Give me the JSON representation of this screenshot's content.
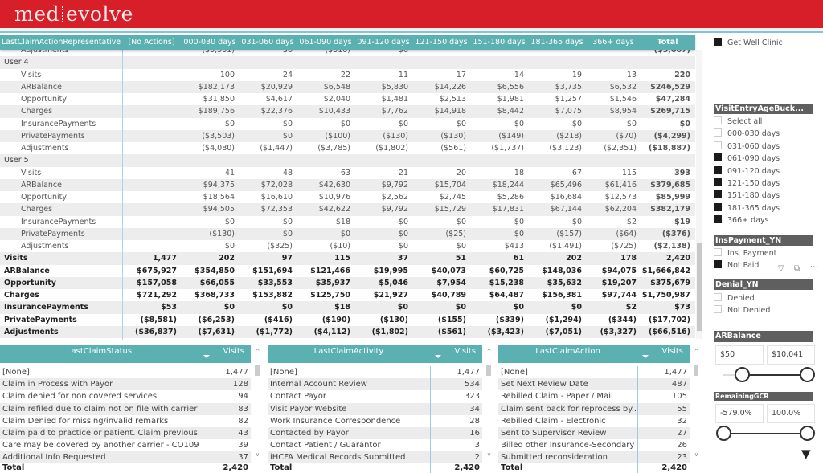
{
  "brand": {
    "logo_left": "med",
    "logo_right": "evolve",
    "color": "#d71f2a",
    "accent": "#5bb0b2"
  },
  "matrix": {
    "headers": [
      "LastClaimActionRepresentative",
      "[No Actions]",
      "000-030 days",
      "031-060 days",
      "061-090 days",
      "091-120 days",
      "121-150 days",
      "151-180 days",
      "181-365 days",
      "366+ days",
      "Total"
    ],
    "rows": [
      {
        "type": "sub",
        "cells": [
          "Adjustments",
          "",
          "($5,551)",
          "$0",
          "($310)",
          "$0",
          "",
          "",
          "",
          "",
          "($5,667)"
        ]
      },
      {
        "type": "grp",
        "cells": [
          "User 4",
          "",
          "",
          "",
          "",
          "",
          "",
          "",
          "",
          "",
          ""
        ]
      },
      {
        "type": "sub",
        "cells": [
          "Visits",
          "",
          "100",
          "24",
          "22",
          "11",
          "17",
          "14",
          "19",
          "13",
          "220"
        ]
      },
      {
        "type": "sub",
        "cells": [
          "ARBalance",
          "",
          "$182,173",
          "$20,929",
          "$6,548",
          "$5,830",
          "$14,226",
          "$6,556",
          "$3,735",
          "$6,532",
          "$246,529"
        ]
      },
      {
        "type": "sub",
        "cells": [
          "Opportunity",
          "",
          "$31,850",
          "$4,617",
          "$2,040",
          "$1,481",
          "$2,513",
          "$1,981",
          "$1,257",
          "$1,546",
          "$47,284"
        ]
      },
      {
        "type": "sub",
        "cells": [
          "Charges",
          "",
          "$189,756",
          "$22,376",
          "$10,433",
          "$7,762",
          "$14,918",
          "$8,442",
          "$7,075",
          "$8,954",
          "$269,715"
        ]
      },
      {
        "type": "sub",
        "cells": [
          "InsurancePayments",
          "",
          "$0",
          "$0",
          "$0",
          "$0",
          "$0",
          "$0",
          "$0",
          "$0",
          "$0"
        ]
      },
      {
        "type": "sub",
        "cells": [
          "PrivatePayments",
          "",
          "($3,503)",
          "$0",
          "($100)",
          "($130)",
          "($130)",
          "($149)",
          "($218)",
          "($70)",
          "($4,299)"
        ]
      },
      {
        "type": "sub",
        "cells": [
          "Adjustments",
          "",
          "($4,080)",
          "($1,447)",
          "($3,785)",
          "($1,802)",
          "($561)",
          "($1,737)",
          "($3,123)",
          "($2,351)",
          "($18,887)"
        ]
      },
      {
        "type": "grp",
        "cells": [
          "User 5",
          "",
          "",
          "",
          "",
          "",
          "",
          "",
          "",
          "",
          ""
        ]
      },
      {
        "type": "sub",
        "cells": [
          "Visits",
          "",
          "41",
          "48",
          "63",
          "21",
          "20",
          "18",
          "67",
          "115",
          "393"
        ]
      },
      {
        "type": "sub",
        "cells": [
          "ARBalance",
          "",
          "$94,375",
          "$72,028",
          "$42,630",
          "$9,792",
          "$15,704",
          "$18,244",
          "$65,496",
          "$61,416",
          "$379,685"
        ]
      },
      {
        "type": "sub",
        "cells": [
          "Opportunity",
          "",
          "$18,564",
          "$16,610",
          "$10,976",
          "$2,562",
          "$2,745",
          "$5,286",
          "$16,684",
          "$12,573",
          "$85,999"
        ]
      },
      {
        "type": "sub",
        "cells": [
          "Charges",
          "",
          "$94,505",
          "$72,353",
          "$42,622",
          "$9,792",
          "$15,729",
          "$17,831",
          "$67,144",
          "$62,204",
          "$382,179"
        ]
      },
      {
        "type": "sub",
        "cells": [
          "InsurancePayments",
          "",
          "$0",
          "$0",
          "$18",
          "$0",
          "$0",
          "$0",
          "$0",
          "$2",
          "$19"
        ]
      },
      {
        "type": "sub",
        "cells": [
          "PrivatePayments",
          "",
          "($130)",
          "$0",
          "$0",
          "$0",
          "($25)",
          "$0",
          "($157)",
          "($64)",
          "($376)"
        ]
      },
      {
        "type": "sub",
        "cells": [
          "Adjustments",
          "",
          "$0",
          "($325)",
          "($10)",
          "$0",
          "$0",
          "$413",
          "($1,491)",
          "($725)",
          "($2,138)"
        ]
      },
      {
        "type": "tot",
        "cells": [
          "Visits",
          "1,477",
          "202",
          "97",
          "115",
          "37",
          "51",
          "61",
          "202",
          "178",
          "2,420"
        ]
      },
      {
        "type": "tot",
        "cells": [
          "ARBalance",
          "$675,927",
          "$354,850",
          "$151,694",
          "$121,466",
          "$19,995",
          "$40,073",
          "$60,725",
          "$148,036",
          "$94,075",
          "$1,666,842"
        ]
      },
      {
        "type": "tot",
        "cells": [
          "Opportunity",
          "$157,058",
          "$66,055",
          "$33,553",
          "$35,937",
          "$5,046",
          "$7,954",
          "$15,238",
          "$35,632",
          "$19,207",
          "$375,679"
        ]
      },
      {
        "type": "tot",
        "cells": [
          "Charges",
          "$721,292",
          "$368,733",
          "$153,882",
          "$125,750",
          "$21,927",
          "$40,789",
          "$64,487",
          "$156,381",
          "$97,744",
          "$1,750,987"
        ]
      },
      {
        "type": "tot",
        "cells": [
          "InsurancePayments",
          "$53",
          "$0",
          "$0",
          "$18",
          "$0",
          "$0",
          "$0",
          "$0",
          "$2",
          "$73"
        ]
      },
      {
        "type": "tot",
        "cells": [
          "PrivatePayments",
          "($8,581)",
          "($6,253)",
          "($416)",
          "($190)",
          "($130)",
          "($155)",
          "($339)",
          "($1,294)",
          "($344)",
          "($17,702)"
        ]
      },
      {
        "type": "tot",
        "cells": [
          "Adjustments",
          "($36,837)",
          "($7,631)",
          "($1,772)",
          "($4,112)",
          "($1,802)",
          "($561)",
          "($3,423)",
          "($7,051)",
          "($3,327)",
          "($66,516)"
        ]
      }
    ]
  },
  "tables": [
    {
      "header": "LastClaimStatus",
      "col": "Visits",
      "rows": [
        [
          "[None]",
          "1,477"
        ],
        [
          "Claim in Process with Payor",
          "128"
        ],
        [
          " Claim denied for non covered services",
          "94"
        ],
        [
          "Claim refiled due to claim not on file with carrier",
          "83"
        ],
        [
          "Claim Denied for missing/invalid remarks",
          "82"
        ],
        [
          "Claim paid to practice or patient.  Claim previous...",
          "43"
        ],
        [
          "Care may be covered by another carrier - CO109",
          "39"
        ],
        [
          "Additional Info Requested",
          "37"
        ]
      ],
      "total_label": "Total",
      "total": "2,420"
    },
    {
      "header": "LastClaimActivity",
      "col": "Visits",
      "rows": [
        [
          "[None]",
          "1,477"
        ],
        [
          "Internal Account Review",
          "534"
        ],
        [
          "Contact Payor",
          "323"
        ],
        [
          "Visit Payor Website",
          "34"
        ],
        [
          "Work Insurance Correspondence",
          "28"
        ],
        [
          "Contacted by Payor",
          "16"
        ],
        [
          "Contact Patient / Guarantor",
          "3"
        ],
        [
          "iHCFA Medical Records Submitted",
          "2"
        ]
      ],
      "total_label": "Total",
      "total": "2,420"
    },
    {
      "header": "LastClaimAction",
      "col": "Visits",
      "rows": [
        [
          "[None]",
          "1,477"
        ],
        [
          "Set Next Review Date",
          "487"
        ],
        [
          "Rebilled Claim - Paper / Mail",
          "105"
        ],
        [
          "Claim sent back for reprocess by...",
          "55"
        ],
        [
          "Rebilled Claim - Electronic",
          "32"
        ],
        [
          "Sent to Supervisor Review",
          "27"
        ],
        [
          "Billed other Insurance-Secondary",
          "26"
        ],
        [
          "Submitted reconsideration",
          "23"
        ]
      ],
      "total_label": "Total",
      "total": "2,420"
    }
  ],
  "filters": {
    "clinic": {
      "label": "Get Well Clinic",
      "checked": true
    },
    "age": {
      "title": "VisitEntryAgeBuck...",
      "items": [
        {
          "label": "Select all",
          "state": "partial"
        },
        {
          "label": "000-030 days",
          "state": "off"
        },
        {
          "label": "031-060 days",
          "state": "off"
        },
        {
          "label": "061-090 days",
          "state": "on"
        },
        {
          "label": "091-120 days",
          "state": "on"
        },
        {
          "label": "121-150 days",
          "state": "on"
        },
        {
          "label": "151-180 days",
          "state": "on"
        },
        {
          "label": "181-365 days",
          "state": "on"
        },
        {
          "label": "366+ days",
          "state": "on"
        }
      ]
    },
    "inspay": {
      "title": "InsPayment_YN",
      "items": [
        {
          "label": "Ins. Payment",
          "state": "off"
        },
        {
          "label": "Not Paid",
          "state": "on"
        }
      ]
    },
    "denial": {
      "title": "Denial_YN",
      "items": [
        {
          "label": "Denied",
          "state": "off"
        },
        {
          "label": "Not Denied",
          "state": "off"
        }
      ]
    },
    "arbalance": {
      "title": "ARBalance",
      "min": "$50",
      "max": "$10,041"
    },
    "gcr": {
      "title": "RemainingGCR",
      "min": "-579.0%",
      "max": "100.0%"
    }
  }
}
